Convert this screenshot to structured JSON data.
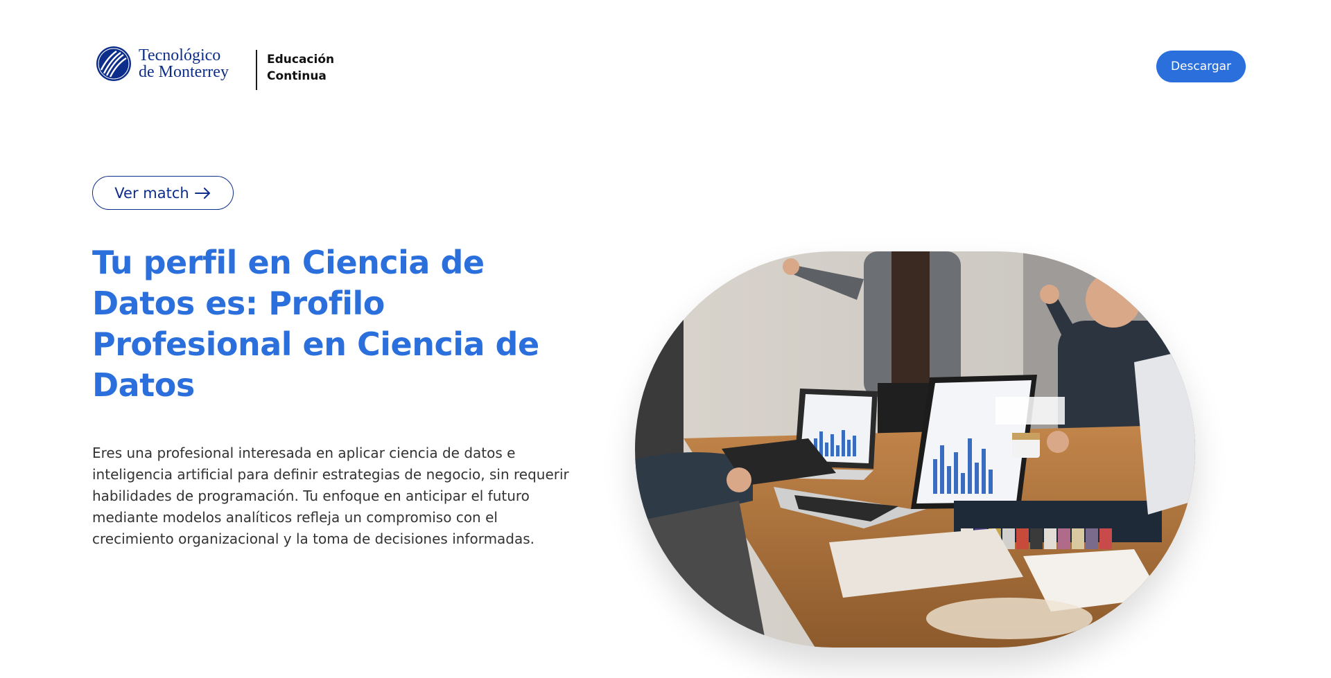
{
  "header": {
    "logo_line1": "Tecnológico",
    "logo_line2": "de Monterrey",
    "edu_line1": "Educación",
    "edu_line2": "Continua",
    "download_label": "Descargar"
  },
  "match": {
    "label": "Ver match"
  },
  "hero": {
    "title_regular": "Tu perfil en Ciencia de Datos es: ",
    "title_strong": "Profilo Profesional en Ciencia de Datos",
    "description": "Eres una profesional interesada en aplicar ciencia de datos e inteligencia artificial para definir estrategias de negocio, sin requerir habilidades de programación. Tu enfoque en anticipar el futuro mediante modelos analíticos refleja un compromiso con el crecimiento organizacional y la toma de decisiones informadas."
  },
  "image": {
    "subject": "team-meeting-laptops-photo"
  },
  "colors": {
    "accent": "#2a6fdb",
    "brand_navy": "#0d2d8a",
    "text": "#333333"
  },
  "icons": {
    "logo": "tec-seal-icon",
    "arrow": "arrow-right-icon"
  }
}
